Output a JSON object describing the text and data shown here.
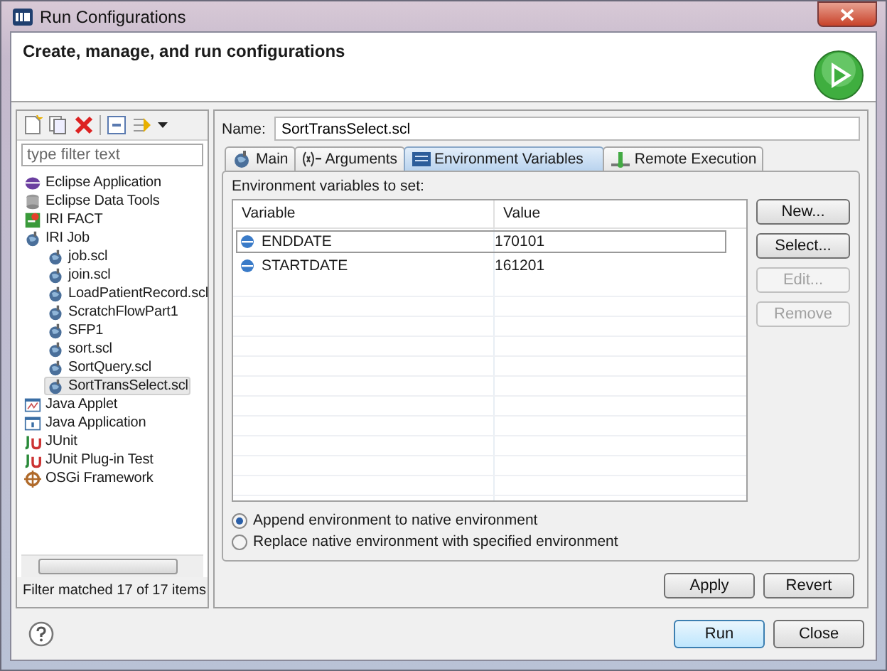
{
  "window": {
    "title": "Run Configurations"
  },
  "header": {
    "title": "Create, manage, and run configurations"
  },
  "filter": {
    "placeholder": "type filter text"
  },
  "tree": [
    {
      "label": "Eclipse Application",
      "kind": "eclipse",
      "selected": false
    },
    {
      "label": "Eclipse Data Tools",
      "kind": "database",
      "selected": false
    },
    {
      "label": "IRI FACT",
      "kind": "fact",
      "selected": false
    },
    {
      "label": "IRI Job",
      "kind": "job",
      "selected": false,
      "children": [
        {
          "label": "job.scl",
          "kind": "job",
          "selected": false
        },
        {
          "label": "join.scl",
          "kind": "job",
          "selected": false
        },
        {
          "label": "LoadPatientRecord.scl",
          "kind": "job",
          "selected": false
        },
        {
          "label": "ScratchFlowPart1",
          "kind": "job",
          "selected": false
        },
        {
          "label": "SFP1",
          "kind": "job",
          "selected": false
        },
        {
          "label": "sort.scl",
          "kind": "job",
          "selected": false
        },
        {
          "label": "SortQuery.scl",
          "kind": "job",
          "selected": false
        },
        {
          "label": "SortTransSelect.scl",
          "kind": "job",
          "selected": true
        }
      ]
    },
    {
      "label": "Java Applet",
      "kind": "applet",
      "selected": false
    },
    {
      "label": "Java Application",
      "kind": "javaapp",
      "selected": false
    },
    {
      "label": "JUnit",
      "kind": "junit",
      "selected": false
    },
    {
      "label": "JUnit Plug-in Test",
      "kind": "junit",
      "selected": false
    },
    {
      "label": "OSGi Framework",
      "kind": "osgi",
      "selected": false
    }
  ],
  "filter_status": "Filter matched 17 of 17 items",
  "name": {
    "label": "Name:",
    "value": "SortTransSelect.scl"
  },
  "tabs": [
    {
      "label": "Main",
      "kind": "job",
      "selected": false
    },
    {
      "label": "Arguments",
      "kind": "args",
      "selected": false
    },
    {
      "label": "Environment Variables",
      "kind": "env",
      "selected": true
    },
    {
      "label": "Remote Execution",
      "kind": "remote",
      "selected": false
    }
  ],
  "env": {
    "label": "Environment variables to set:",
    "columns": [
      "Variable",
      "Value"
    ],
    "rows": [
      {
        "variable": "ENDDATE",
        "value": "170101",
        "selected": true
      },
      {
        "variable": "STARTDATE",
        "value": "161201",
        "selected": false
      }
    ],
    "buttons": [
      {
        "label": "New...",
        "disabled": false
      },
      {
        "label": "Select...",
        "disabled": false
      },
      {
        "label": "Edit...",
        "disabled": true
      },
      {
        "label": "Remove",
        "disabled": true
      }
    ],
    "options": [
      {
        "label": "Append environment to native environment",
        "selected": true
      },
      {
        "label": "Replace native environment with specified environment",
        "selected": false
      }
    ]
  },
  "apply_buttons": [
    "Apply",
    "Revert"
  ],
  "dialog_buttons": [
    {
      "label": "Run",
      "default": true
    },
    {
      "label": "Close",
      "default": false
    }
  ]
}
